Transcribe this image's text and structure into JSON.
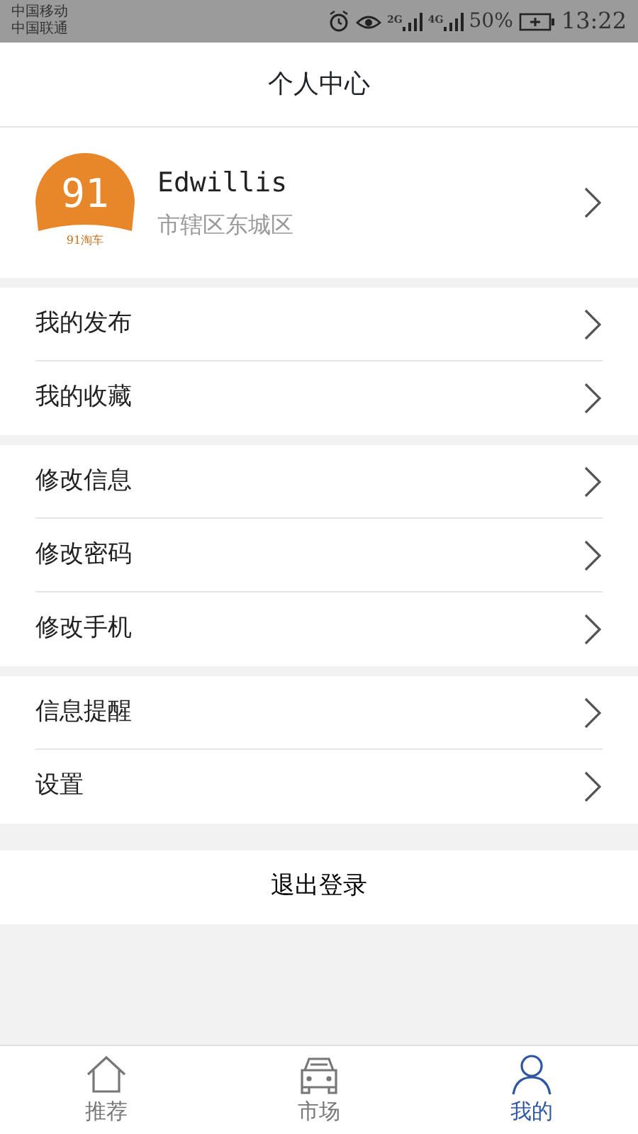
{
  "status_bar": {
    "carriers": [
      "中国移动",
      "中国联通"
    ],
    "network_1": "2G",
    "network_2": "4G",
    "battery": "50%",
    "time": "13:22"
  },
  "title": "个人中心",
  "profile": {
    "logo_number": "91",
    "logo_caption": "91淘车",
    "name": "Edwillis",
    "location": "市辖区东城区"
  },
  "groups": [
    {
      "items": [
        "我的发布",
        "我的收藏"
      ]
    },
    {
      "items": [
        "修改信息",
        "修改密码",
        "修改手机"
      ]
    },
    {
      "items": [
        "信息提醒",
        "设置"
      ]
    }
  ],
  "logout": "退出登录",
  "tabs": [
    {
      "label": "推荐",
      "kind": "home",
      "selected": false
    },
    {
      "label": "市场",
      "kind": "car",
      "selected": false
    },
    {
      "label": "我的",
      "kind": "person",
      "selected": true
    }
  ]
}
